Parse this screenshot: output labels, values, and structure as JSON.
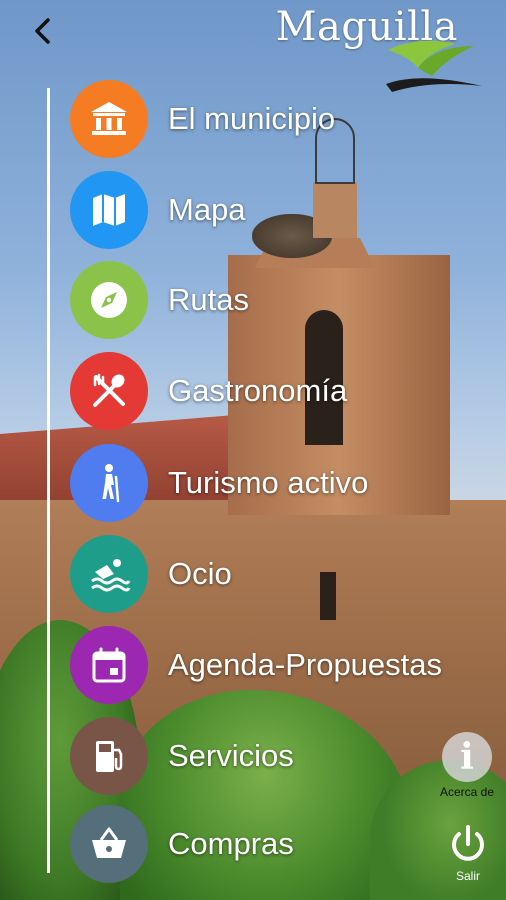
{
  "header": {
    "back_icon": "chevron-left-icon",
    "logo_text": "Maguilla"
  },
  "menu": {
    "items": [
      {
        "label": "El municipio",
        "icon": "bank-building-icon",
        "color": "#f57c22"
      },
      {
        "label": "Mapa",
        "icon": "map-icon",
        "color": "#2196f3"
      },
      {
        "label": "Rutas",
        "icon": "compass-icon",
        "color": "#8bc34a"
      },
      {
        "label": "Gastronomía",
        "icon": "utensils-icon",
        "color": "#e53935"
      },
      {
        "label": "Turismo activo",
        "icon": "hiker-icon",
        "color": "#4f7df0"
      },
      {
        "label": "Ocio",
        "icon": "swimmer-icon",
        "color": "#1e9e8a"
      },
      {
        "label": "Agenda-Propuestas",
        "icon": "calendar-icon",
        "color": "#9c27b0"
      },
      {
        "label": "Servicios",
        "icon": "fuel-pump-icon",
        "color": "#795548"
      },
      {
        "label": "Compras",
        "icon": "shopping-basket-icon",
        "color": "#546e7a"
      }
    ]
  },
  "side": {
    "about_label": "Acerca de",
    "about_icon": "info-icon",
    "about_glyph": "i",
    "exit_label": "Salir",
    "exit_icon": "power-icon"
  },
  "colors": {
    "divider": "#ffffff",
    "label_text": "#ffffff"
  }
}
